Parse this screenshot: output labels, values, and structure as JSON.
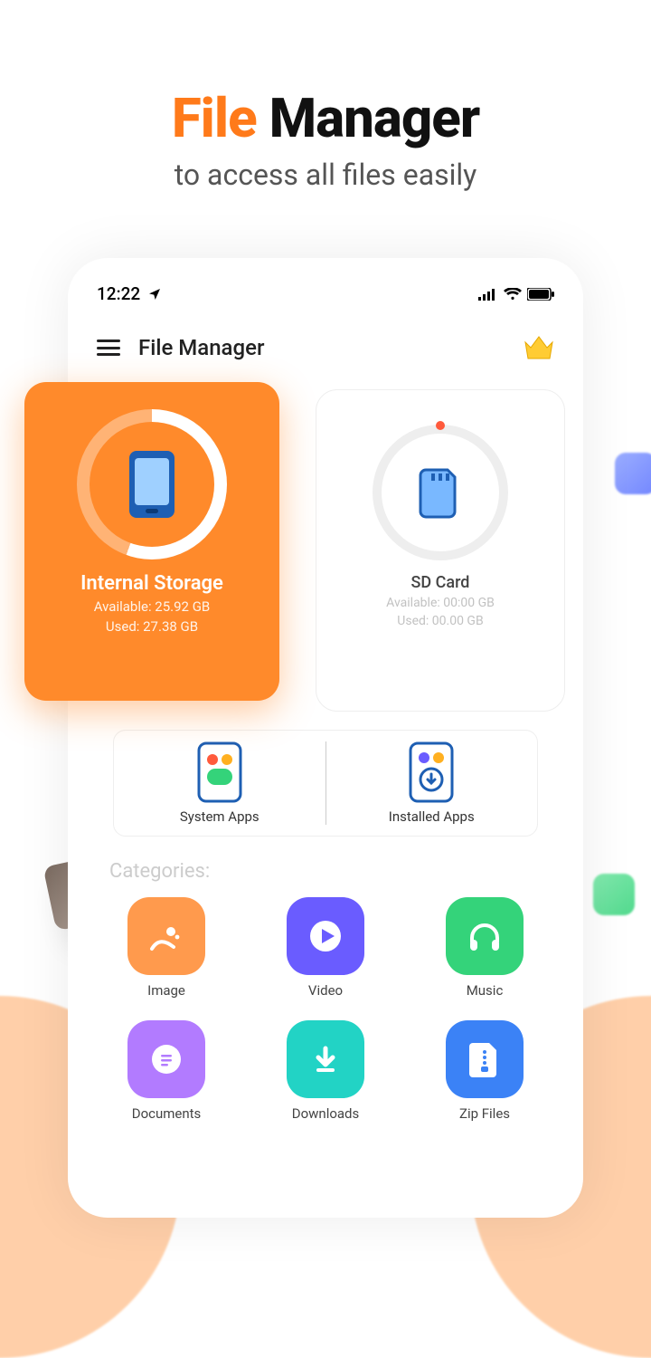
{
  "hero": {
    "title_part1": "File",
    "title_part2": " Manager",
    "subtitle": "to access all files easily"
  },
  "statusbar": {
    "time": "12:22"
  },
  "appbar": {
    "title": "File Manager"
  },
  "storage": {
    "internal": {
      "title": "Internal Storage",
      "available": "Available: 25.92 GB",
      "used": "Used: 27.38 GB"
    },
    "sd": {
      "title": "SD Card",
      "available": "Available: 00:00 GB",
      "used": "Used: 00.00 GB"
    }
  },
  "apps": {
    "system": "System Apps",
    "installed": "Installed Apps"
  },
  "categories_label": "Categories:",
  "categories": [
    {
      "label": "Image",
      "color": "#ff9a4d"
    },
    {
      "label": "Video",
      "color": "#6a5cff"
    },
    {
      "label": "Music",
      "color": "#34d37a"
    },
    {
      "label": "Documents",
      "color": "#b27bff"
    },
    {
      "label": "Downloads",
      "color": "#22d3c5"
    },
    {
      "label": "Zip Files",
      "color": "#3b82f6"
    }
  ]
}
